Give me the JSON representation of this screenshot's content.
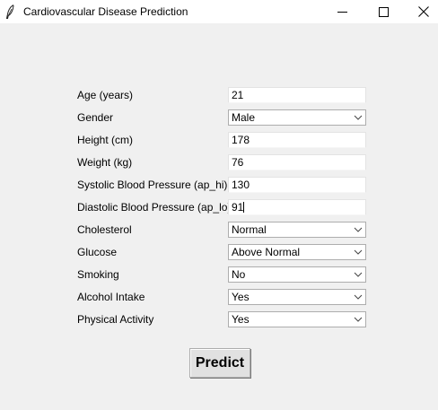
{
  "window": {
    "title": "Cardiovascular Disease Prediction"
  },
  "form": {
    "age": {
      "label": "Age (years)",
      "value": "21"
    },
    "gender": {
      "label": "Gender",
      "value": "Male"
    },
    "height": {
      "label": "Height (cm)",
      "value": "178"
    },
    "weight": {
      "label": "Weight (kg)",
      "value": "76"
    },
    "ap_hi": {
      "label": "Systolic Blood Pressure (ap_hi)",
      "value": "130"
    },
    "ap_lo": {
      "label": "Diastolic Blood Pressure (ap_lo)",
      "value": "91"
    },
    "cholesterol": {
      "label": "Cholesterol",
      "value": "Normal"
    },
    "glucose": {
      "label": "Glucose",
      "value": "Above Normal"
    },
    "smoking": {
      "label": "Smoking",
      "value": "No"
    },
    "alcohol": {
      "label": "Alcohol Intake",
      "value": "Yes"
    },
    "activity": {
      "label": "Physical Activity",
      "value": "Yes"
    }
  },
  "predict_label": "Predict",
  "icons": {
    "app": "feather-icon",
    "minimize": "minimize-icon",
    "maximize": "maximize-icon",
    "close": "close-icon",
    "dropdown": "chevron-down-icon"
  }
}
